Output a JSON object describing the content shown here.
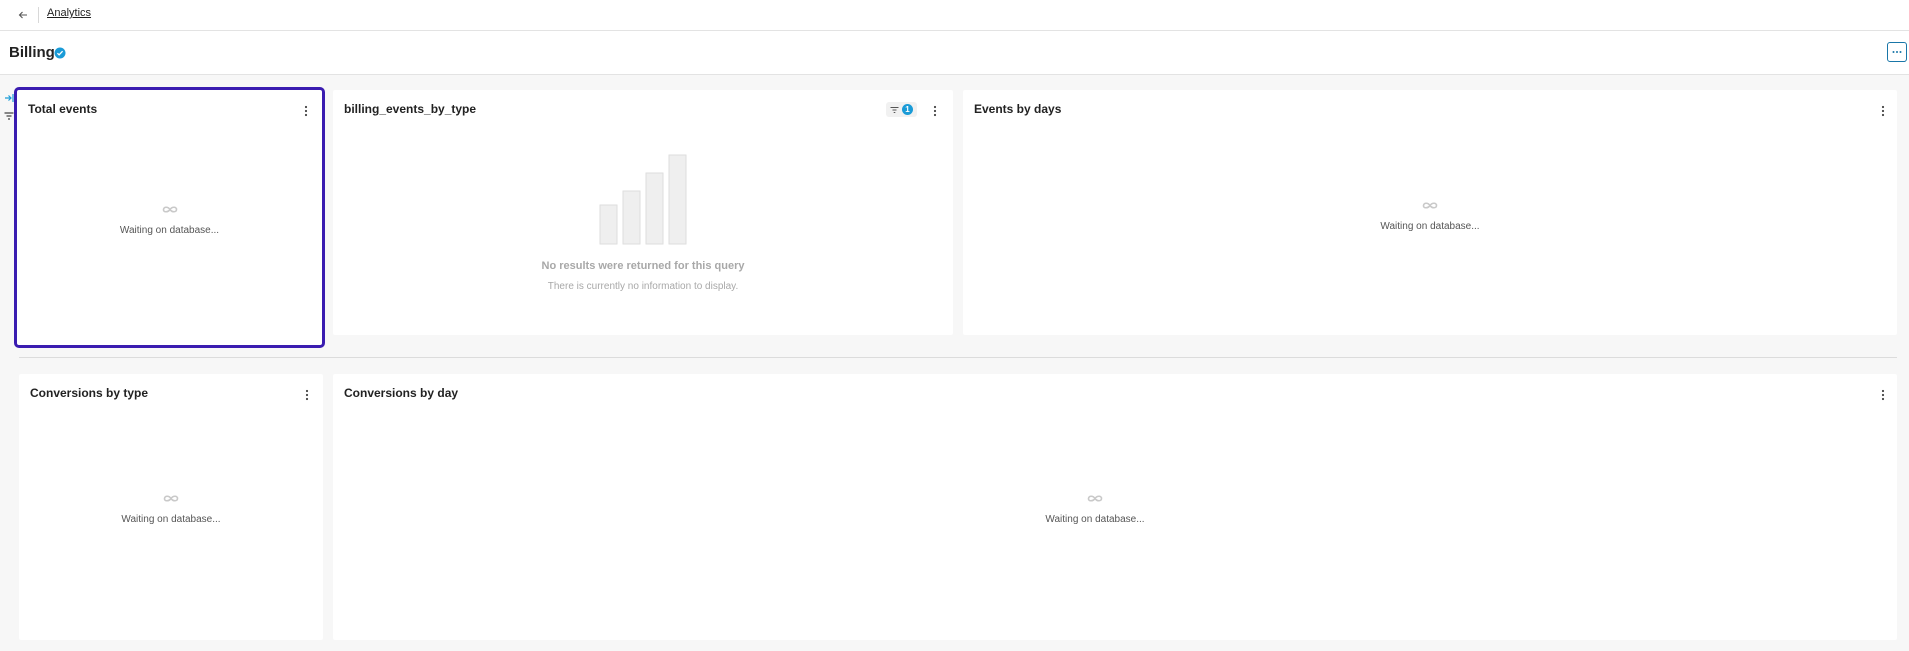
{
  "topbar": {
    "breadcrumb": "Analytics"
  },
  "header": {
    "title": "Billing"
  },
  "cards": {
    "total_events": {
      "title": "Total events",
      "status": "Waiting on database..."
    },
    "billing_events": {
      "title": "billing_events_by_type",
      "filter_count": "1",
      "empty_title": "No results were returned for this query",
      "empty_subtitle": "There is currently no information to display."
    },
    "events_by_days": {
      "title": "Events by days",
      "status": "Waiting on database..."
    },
    "conversions_by_type": {
      "title": "Conversions by type",
      "status": "Waiting on database..."
    },
    "conversions_by_day": {
      "title": "Conversions by day",
      "status": "Waiting on database..."
    }
  },
  "icons": {
    "back": "arrow-left-icon",
    "verified": "verified-badge-icon",
    "more": "ellipsis-icon",
    "kebab": "vertical-dots-icon",
    "loading": "infinity-spinner-icon",
    "filter": "filter-icon",
    "collapse": "collapse-panel-icon",
    "empty_chart": "empty-bar-chart-icon"
  },
  "colors": {
    "accent": "#1a9bd7",
    "selection": "#3a1cb0",
    "verified": "#1a9bd7"
  }
}
